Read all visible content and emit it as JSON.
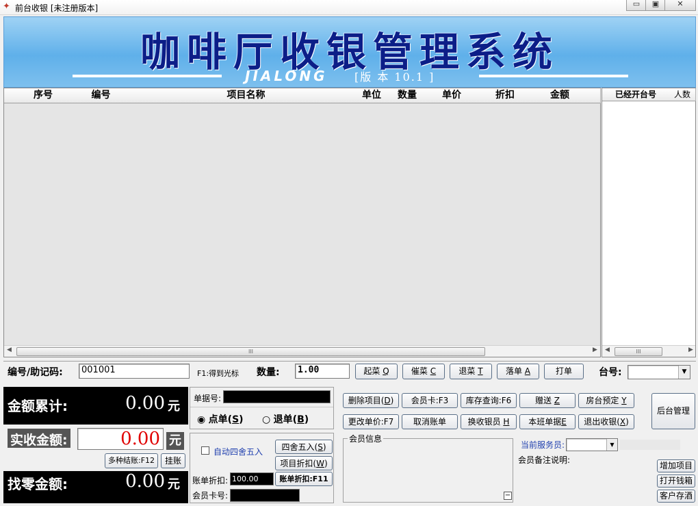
{
  "window": {
    "title": "前台收银 [未注册版本]",
    "min": "▭",
    "max": "▣",
    "close": "✕"
  },
  "banner": {
    "title": "咖啡厅收银管理系统",
    "brand": "JIALONG",
    "version": "[版 本  10.1  ]"
  },
  "grid": {
    "columns": [
      "序号",
      "编号",
      "项目名称",
      "单位",
      "数量",
      "单价",
      "折扣",
      "金额"
    ],
    "rows": [],
    "scroll_thumb": "III"
  },
  "tables_panel": {
    "columns": [
      "已经开台号",
      "人数"
    ],
    "scroll_thumb": "III"
  },
  "input_row": {
    "code_label": "编号/助记码:",
    "code_value": "001001",
    "hint": "F1:得到光标",
    "qty_label": "数量:",
    "qty_value": "1.00",
    "buttons": [
      {
        "text": "起菜 ",
        "key": "Q"
      },
      {
        "text": "催菜 ",
        "key": "C"
      },
      {
        "text": "退菜 ",
        "key": "T"
      },
      {
        "text": "落单 ",
        "key": "A"
      },
      {
        "text": "打单",
        "key": ""
      }
    ],
    "table_label": "台号:",
    "table_value": ""
  },
  "summary": {
    "total_label": "金额累计:",
    "total_value": "0.00",
    "received_label": "实收金额:",
    "received_value": "0.00",
    "change_label": "找零金额:",
    "change_value": "0.00",
    "unit": "元",
    "multi_pay": "多种结账:F12",
    "hang": "挂账"
  },
  "bill": {
    "bill_no_label": "单据号:",
    "bill_no_value": "",
    "order_label": "点单(",
    "order_key": "S",
    "return_label": "退单(",
    "return_key": "B",
    "close_paren": ")",
    "auto_round": "自动四舍五入",
    "round_btn": "四舍五入(",
    "round_key": "S",
    "item_discount": "项目折扣(",
    "item_discount_key": "W",
    "bill_discount_label": "账单折扣:",
    "bill_discount_value": "100.00",
    "bill_discount_btn": "账单折扣:F11",
    "member_card_label": "会员卡号:",
    "member_card_value": ""
  },
  "actions": {
    "row1": [
      {
        "text": "删除项目(",
        "key": "D",
        "end": ")"
      },
      {
        "text": "会员卡:F3",
        "key": "",
        "end": ""
      },
      {
        "text": "库存查询:F6",
        "key": "",
        "end": ""
      },
      {
        "text": "赠送 ",
        "key": "Z",
        "end": ""
      },
      {
        "text": "房台预定 ",
        "key": "Y",
        "end": ""
      }
    ],
    "row2": [
      {
        "text": "更改单价:F7",
        "key": "",
        "end": ""
      },
      {
        "text": "取消账单",
        "key": "",
        "end": ""
      },
      {
        "text": "换收银员 ",
        "key": "H",
        "end": ""
      },
      {
        "text": "本班单据",
        "key": "E",
        "end": ""
      },
      {
        "text": "退出收银(",
        "key": "X",
        "end": ")"
      }
    ],
    "backend": "后台管理"
  },
  "member": {
    "title": "会员信息",
    "collapse": "−"
  },
  "service": {
    "waiter_label": "当前服务员:",
    "waiter_value": "",
    "note_label": "会员备注说明:"
  },
  "side_buttons": [
    "增加项目",
    "打开钱箱",
    "客户存酒"
  ],
  "colors": {
    "banner_blue": "#5fb0ea",
    "title_navy": "#0c1e88",
    "received_red": "#e00000"
  }
}
